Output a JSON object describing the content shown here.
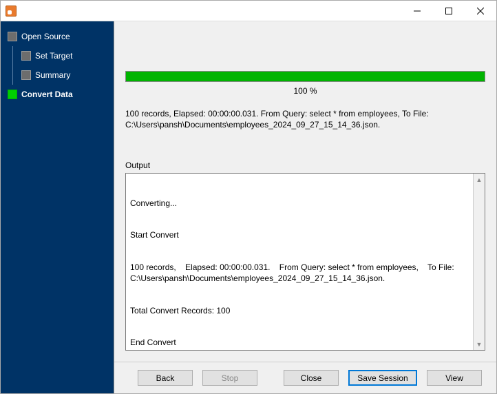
{
  "window": {
    "title": ""
  },
  "sidebar": {
    "steps": [
      {
        "label": "Open Source"
      },
      {
        "label": "Set Target"
      },
      {
        "label": "Summary"
      },
      {
        "label": "Convert Data"
      }
    ]
  },
  "progress": {
    "percent_text": "100 %",
    "fill_width": "100%"
  },
  "summary": {
    "line1": "100 records,    Elapsed: 00:00:00.031.    From Query: select * from employees,    To File:",
    "line2": "C:\\Users\\pansh\\Documents\\employees_2024_09_27_15_14_36.json."
  },
  "output": {
    "label": "Output",
    "lines": [
      "Converting...",
      "Start Convert",
      "100 records,    Elapsed: 00:00:00.031.    From Query: select * from employees,    To File: C:\\Users\\pansh\\Documents\\employees_2024_09_27_15_14_36.json.",
      "Total Convert Records: 100",
      "End Convert"
    ]
  },
  "footer": {
    "back": "Back",
    "stop": "Stop",
    "close": "Close",
    "save_session": "Save Session",
    "view": "View"
  }
}
